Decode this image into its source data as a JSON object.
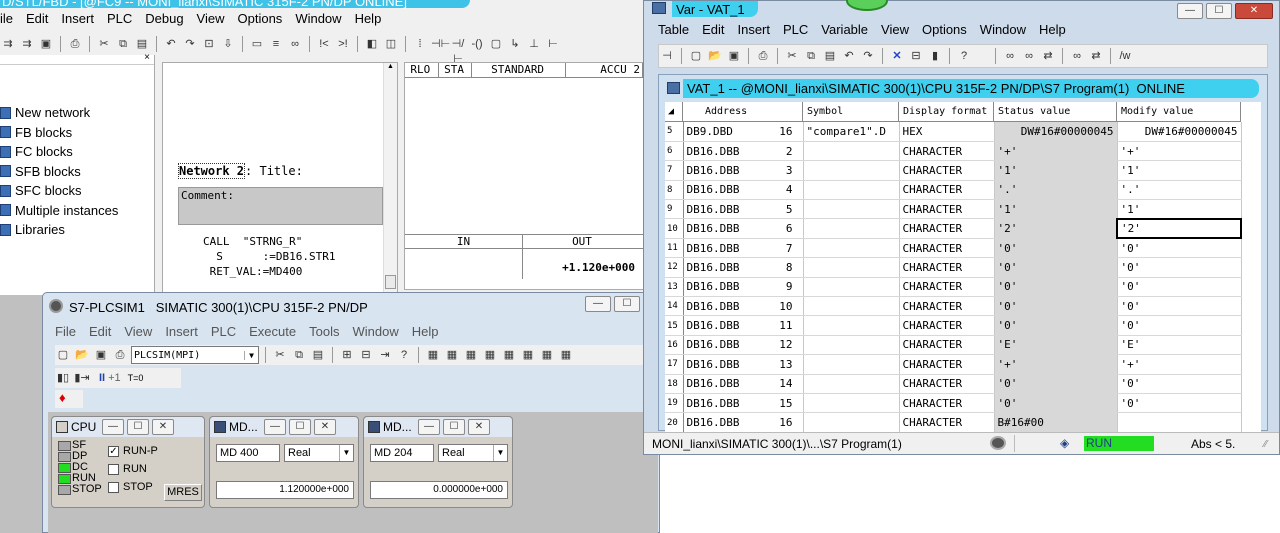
{
  "lad": {
    "title": "D/STL/FBD - [@FC9 -- MONI_lianxi\\SIMATIC 315F-2 PN/DP ONLINE]",
    "menu": [
      "ile",
      "Edit",
      "Insert",
      "PLC",
      "Debug",
      "View",
      "Options",
      "Window",
      "Help"
    ],
    "tree": [
      "New network",
      "FB blocks",
      "FC blocks",
      "SFB blocks",
      "SFC blocks",
      "Multiple instances",
      "Libraries"
    ],
    "network_label": "Network 2",
    "network_title": ": Title:",
    "comment_label": "Comment:",
    "code": [
      "CALL  \"STRNG_R\"",
      "  S      :=DB16.STR1",
      " RET_VAL:=MD400"
    ],
    "status_headers": [
      "RLO",
      "STA",
      "STANDARD",
      "ACCU 2"
    ],
    "io_headers": [
      "IN",
      "OUT"
    ],
    "out_value": "+1.120e+000"
  },
  "plcsim": {
    "title": "S7-PLCSIM1   SIMATIC 300(1)\\CPU 315F-2 PN/DP",
    "menu": [
      "File",
      "Edit",
      "View",
      "Insert",
      "PLC",
      "Execute",
      "Tools",
      "Window",
      "Help"
    ],
    "interface": "PLCSIM(MPI)",
    "run_controls": [
      "II",
      "+1",
      "T=0"
    ],
    "cpu": {
      "title": "CPU",
      "leds": [
        {
          "label": "SF",
          "color": "#a8a8a8"
        },
        {
          "label": "DP",
          "color": "#a8a8a8"
        },
        {
          "label": "DC",
          "color": "#22dd22"
        },
        {
          "label": "RUN",
          "color": "#22dd22"
        },
        {
          "label": "STOP",
          "color": "#a8a8a8"
        }
      ],
      "modes": [
        {
          "label": "RUN-P",
          "checked": true
        },
        {
          "label": "RUN",
          "checked": false
        },
        {
          "label": "STOP",
          "checked": false
        }
      ],
      "mres": "MRES"
    },
    "md_panels": [
      {
        "title": "MD...",
        "address": "MD  400",
        "format": "Real",
        "value": "1.120000e+000"
      },
      {
        "title": "MD...",
        "address": "MD  204",
        "format": "Real",
        "value": "0.000000e+000"
      }
    ]
  },
  "var": {
    "title": "Var - VAT_1",
    "menu": [
      "Table",
      "Edit",
      "Insert",
      "PLC",
      "Variable",
      "View",
      "Options",
      "Window",
      "Help"
    ],
    "subtitle": "VAT_1 -- @MONI_lianxi\\SIMATIC 300(1)\\CPU 315F-2 PN/DP\\S7 Program(1)  ONLINE",
    "columns": [
      "Address",
      "Symbol",
      "Display format",
      "Status value",
      "Modify value"
    ],
    "rows": [
      {
        "n": "5",
        "addr": "DB9.DBD",
        "idx": "16",
        "sym": "\"compare1\".D",
        "fmt": "HEX",
        "status": "DW#16#00000045",
        "modify": "DW#16#00000045"
      },
      {
        "n": "6",
        "addr": "DB16.DBB",
        "idx": "2",
        "sym": "",
        "fmt": "CHARACTER",
        "status": "'+'",
        "modify": "'+'"
      },
      {
        "n": "7",
        "addr": "DB16.DBB",
        "idx": "3",
        "sym": "",
        "fmt": "CHARACTER",
        "status": "'1'",
        "modify": "'1'"
      },
      {
        "n": "8",
        "addr": "DB16.DBB",
        "idx": "4",
        "sym": "",
        "fmt": "CHARACTER",
        "status": "'.'",
        "modify": "'.'"
      },
      {
        "n": "9",
        "addr": "DB16.DBB",
        "idx": "5",
        "sym": "",
        "fmt": "CHARACTER",
        "status": "'1'",
        "modify": "'1'"
      },
      {
        "n": "10",
        "addr": "DB16.DBB",
        "idx": "6",
        "sym": "",
        "fmt": "CHARACTER",
        "status": "'2'",
        "modify": "'2'"
      },
      {
        "n": "11",
        "addr": "DB16.DBB",
        "idx": "7",
        "sym": "",
        "fmt": "CHARACTER",
        "status": "'0'",
        "modify": "'0'"
      },
      {
        "n": "12",
        "addr": "DB16.DBB",
        "idx": "8",
        "sym": "",
        "fmt": "CHARACTER",
        "status": "'0'",
        "modify": "'0'"
      },
      {
        "n": "13",
        "addr": "DB16.DBB",
        "idx": "9",
        "sym": "",
        "fmt": "CHARACTER",
        "status": "'0'",
        "modify": "'0'"
      },
      {
        "n": "14",
        "addr": "DB16.DBB",
        "idx": "10",
        "sym": "",
        "fmt": "CHARACTER",
        "status": "'0'",
        "modify": "'0'"
      },
      {
        "n": "15",
        "addr": "DB16.DBB",
        "idx": "11",
        "sym": "",
        "fmt": "CHARACTER",
        "status": "'0'",
        "modify": "'0'"
      },
      {
        "n": "16",
        "addr": "DB16.DBB",
        "idx": "12",
        "sym": "",
        "fmt": "CHARACTER",
        "status": "'E'",
        "modify": "'E'"
      },
      {
        "n": "17",
        "addr": "DB16.DBB",
        "idx": "13",
        "sym": "",
        "fmt": "CHARACTER",
        "status": "'+'",
        "modify": "'+'"
      },
      {
        "n": "18",
        "addr": "DB16.DBB",
        "idx": "14",
        "sym": "",
        "fmt": "CHARACTER",
        "status": "'0'",
        "modify": "'0'"
      },
      {
        "n": "19",
        "addr": "DB16.DBB",
        "idx": "15",
        "sym": "",
        "fmt": "CHARACTER",
        "status": "'0'",
        "modify": "'0'"
      },
      {
        "n": "20",
        "addr": "DB16.DBB",
        "idx": "16",
        "sym": "",
        "fmt": "CHARACTER",
        "status": "B#16#00",
        "modify": ""
      }
    ],
    "status_bar": {
      "path": "MONI_lianxi\\SIMATIC 300(1)\\...\\S7 Program(1)",
      "run": "RUN",
      "abs": "Abs < 5."
    }
  }
}
